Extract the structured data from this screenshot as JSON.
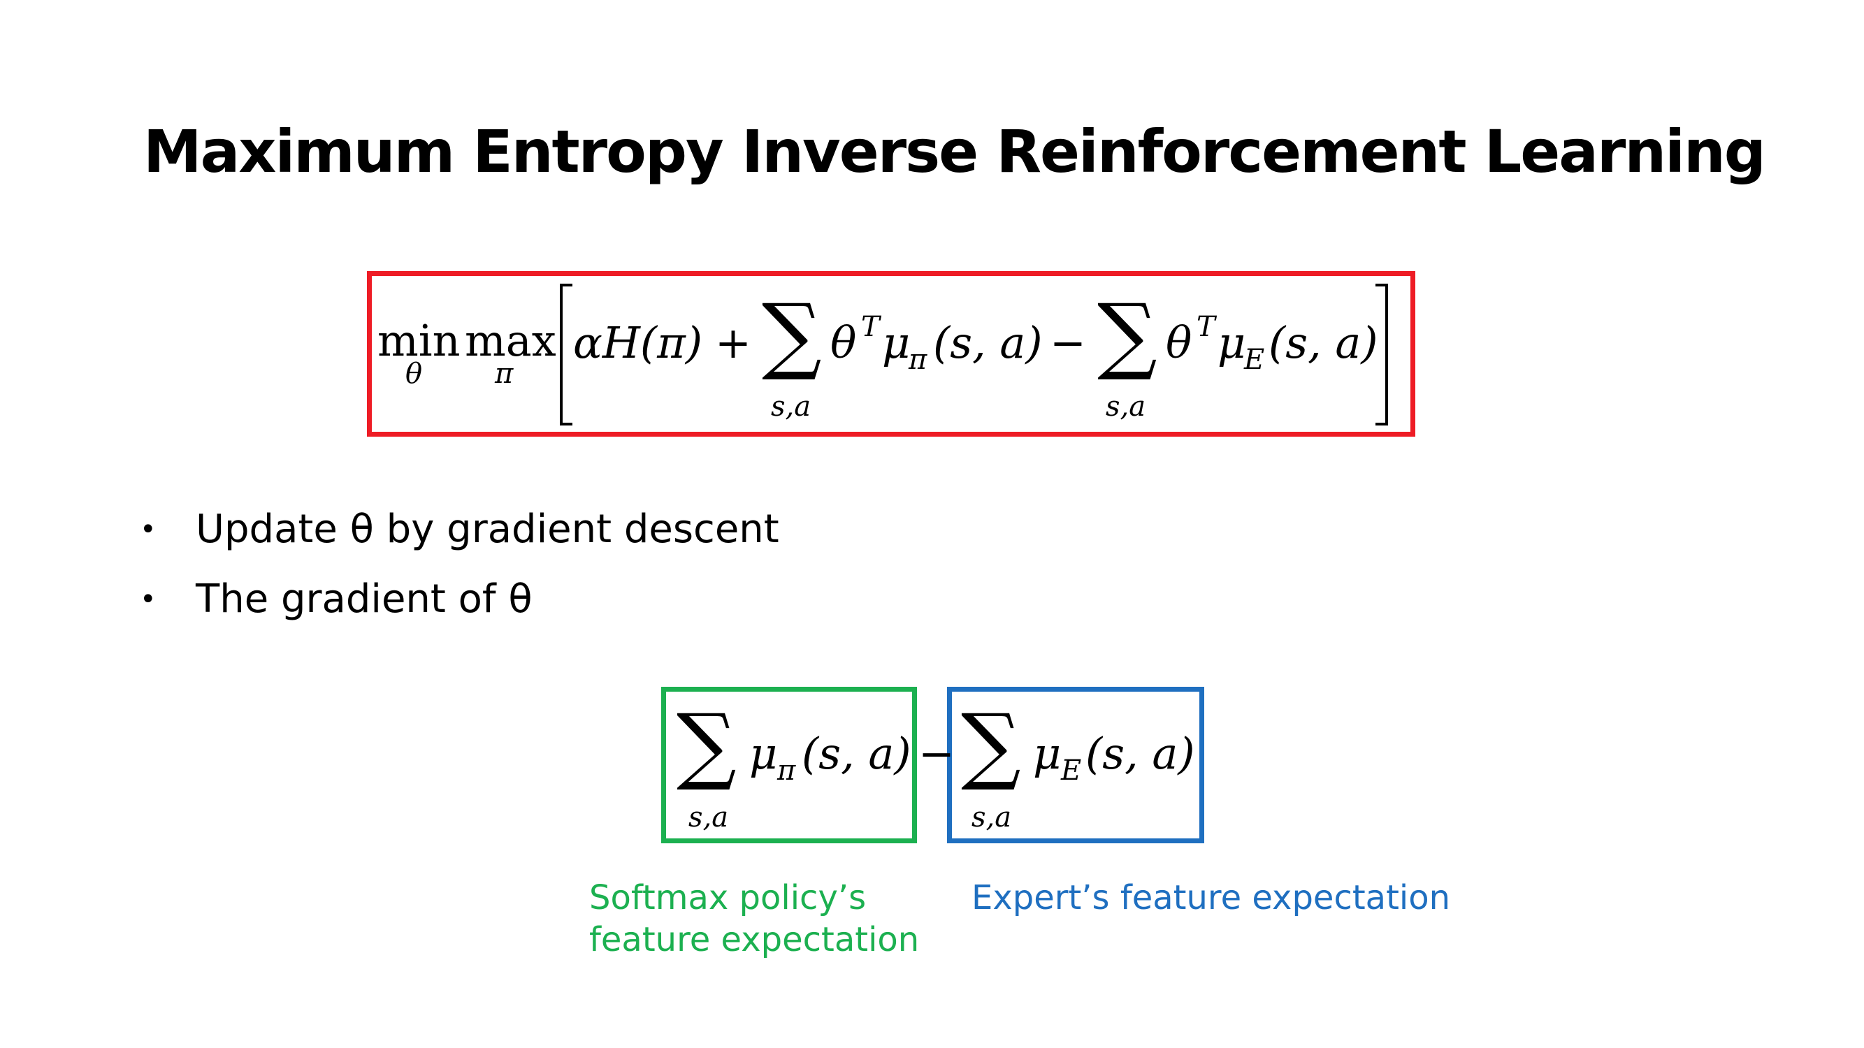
{
  "slide": {
    "title": "Maximum Entropy Inverse Reinforcement Learning"
  },
  "objective": {
    "min_op": "min",
    "min_var": "θ",
    "max_op": "max",
    "max_var": "π",
    "alpha_H": "αH(π)",
    "plus": "+",
    "minus": "−",
    "sum_symbol": "∑",
    "sum_index": "s,a",
    "theta": "θ",
    "transpose": "T",
    "mu": "μ",
    "pi_sub": "π",
    "e_sub": "E",
    "args": "(s, a)"
  },
  "bullets": [
    {
      "text": "Update θ by gradient descent"
    },
    {
      "text": "The gradient of θ"
    }
  ],
  "gradient": {
    "sum_symbol": "∑",
    "sum_index": "s,a",
    "mu": "μ",
    "pi_sub": "π",
    "e_sub": "E",
    "args": "(s, a)",
    "minus": "−"
  },
  "captions": {
    "policy_line1": "Softmax policy’s",
    "policy_line2": "feature expectation",
    "expert": "Expert’s feature expectation"
  },
  "colors": {
    "objective_box": "#ee1c25",
    "policy_box": "#1cb050",
    "expert_box": "#1f6fc0"
  }
}
